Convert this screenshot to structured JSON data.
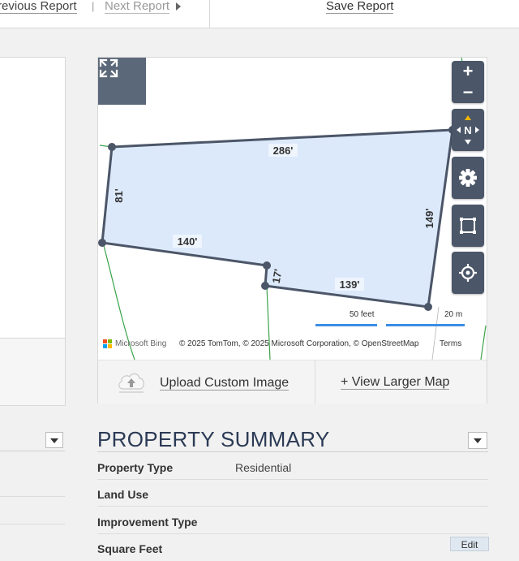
{
  "topbar": {
    "previous_label": "revious Report",
    "separator": "|",
    "next_label": "Next Report",
    "save_label": "Save Report"
  },
  "map": {
    "edge_labels": [
      "286'",
      "81'",
      "149'",
      "140'",
      "17'",
      "139'"
    ],
    "scale_feet": "50 feet",
    "scale_meters": "20 m",
    "bing_label": "Microsoft Bing",
    "attribution": "© 2025 TomTom, © 2025 Microsoft Corporation, © OpenStreetMap",
    "terms_label": "Terms",
    "compass_label": "N",
    "zoom_in": "+",
    "zoom_out": "−",
    "parcel_fill": "#dce9fb",
    "parcel_stroke": "#4b5668",
    "road_color": "#3aa34a",
    "control_color": "#4b5668"
  },
  "map_actions": {
    "upload_label": "Upload Custom Image",
    "larger_map_label": "+ View Larger Map"
  },
  "summary": {
    "title": "PROPERTY SUMMARY",
    "rows": [
      {
        "key": "Property Type",
        "value": "Residential"
      },
      {
        "key": "Land Use",
        "value": ""
      },
      {
        "key": "Improvement Type",
        "value": ""
      },
      {
        "key": "Square Feet",
        "value": ""
      }
    ],
    "edit_label": "Edit"
  }
}
